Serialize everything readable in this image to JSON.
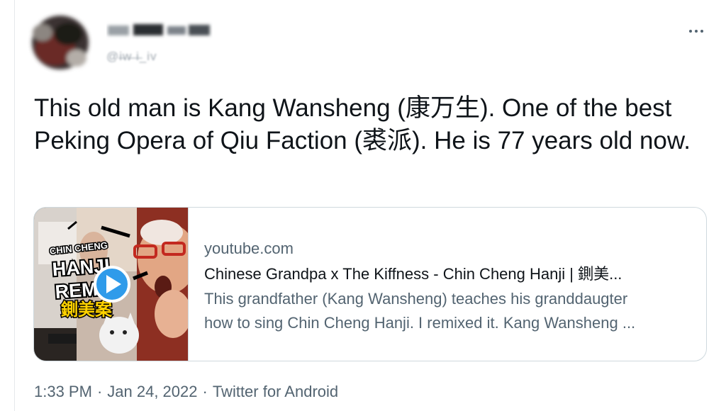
{
  "tweet": {
    "handle": "@i̶w̶ ̶i̶_iv",
    "text": "This old man is Kang Wansheng (康万生). One of the best Peking Opera of Qiu Faction (裘派). He is 77 years old now."
  },
  "card": {
    "domain": "youtube.com",
    "title": "Chinese Grandpa x The Kiffness - Chin Cheng Hanji | 鍘美...",
    "description_line1": "This grandfather (Kang Wansheng) teaches his granddaugter",
    "description_line2": "how to sing Chin Cheng Hanji. I remixed it. Kang Wansheng ...",
    "thumbnail_text": {
      "line1": "CHIN CHENG",
      "line2": "HANJI",
      "line3": "REMIX",
      "chinese": "鍘美案"
    }
  },
  "meta": {
    "time": "1:33 PM",
    "sep1": "·",
    "date": "Jan 24, 2022",
    "sep2": "·",
    "source": "Twitter for Android"
  },
  "colors": {
    "text_primary": "#0f1419",
    "text_secondary": "#536471",
    "border": "#cfd9de",
    "play_blue": "#2f9bea"
  }
}
